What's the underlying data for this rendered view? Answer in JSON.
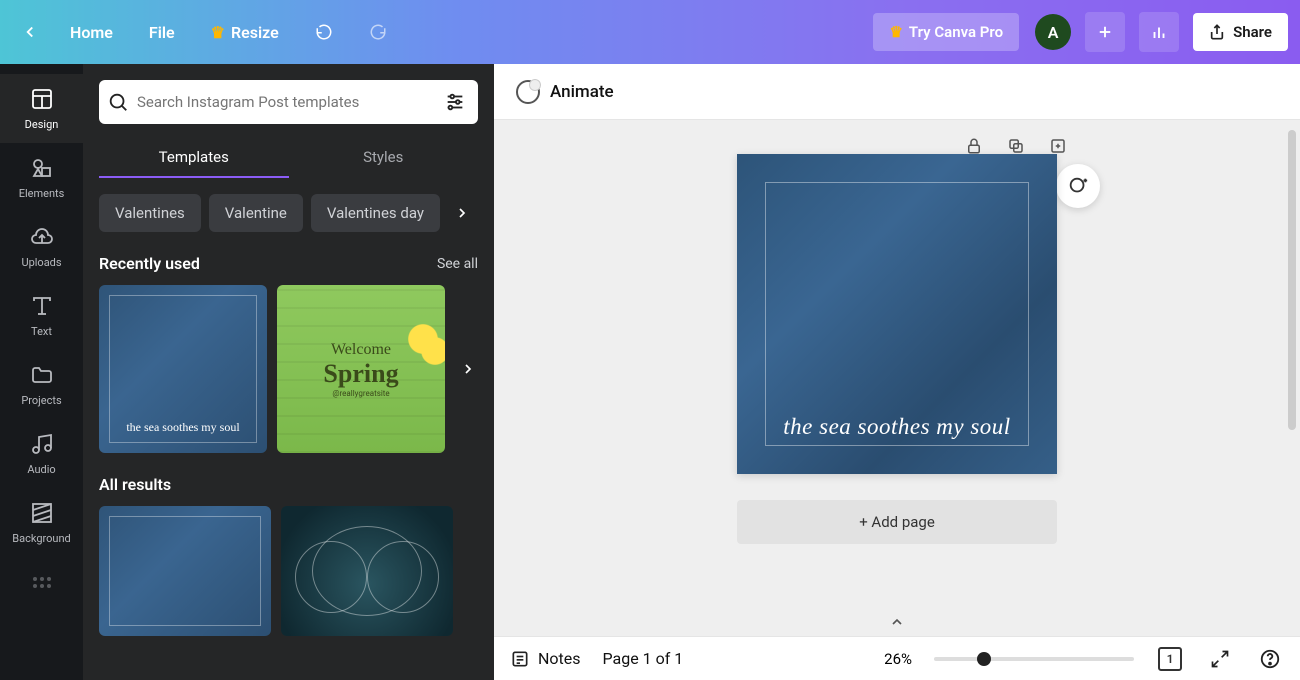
{
  "header": {
    "home": "Home",
    "file": "File",
    "resize": "Resize",
    "try_pro": "Try Canva Pro",
    "avatar_initial": "A",
    "share": "Share"
  },
  "rail": {
    "items": [
      {
        "label": "Design"
      },
      {
        "label": "Elements"
      },
      {
        "label": "Uploads"
      },
      {
        "label": "Text"
      },
      {
        "label": "Projects"
      },
      {
        "label": "Audio"
      },
      {
        "label": "Background"
      }
    ]
  },
  "panel": {
    "search_placeholder": "Search Instagram Post templates",
    "tabs": {
      "templates": "Templates",
      "styles": "Styles"
    },
    "chips": [
      "Valentines",
      "Valentine",
      "Valentines day"
    ],
    "recently_used_title": "Recently used",
    "see_all": "See all",
    "all_results_title": "All results",
    "thumb_sea_text": "the sea soothes my soul",
    "spring_welcome": "Welcome",
    "spring_title": "Spring",
    "spring_handle": "@reallygreatsite"
  },
  "canvas": {
    "animate": "Animate",
    "design_text": "the sea soothes my soul",
    "add_page": "+ Add page"
  },
  "bottom": {
    "notes": "Notes",
    "page_info": "Page 1 of 1",
    "zoom": "26%",
    "page_box": "1"
  }
}
